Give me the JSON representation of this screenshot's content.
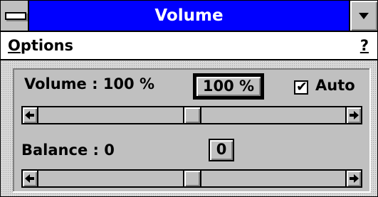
{
  "window": {
    "title": "Volume"
  },
  "menu": {
    "options_label": "Options",
    "help_label": "?"
  },
  "volume": {
    "label": "Volume :  100 %",
    "button_label": "100 %",
    "auto_label": "Auto",
    "auto_checked": true,
    "slider_level": 0.5
  },
  "balance": {
    "label": "Balance :  0",
    "button_label": "0",
    "slider_level": 0.5
  },
  "icons": {
    "system_menu": "system-menu-icon",
    "minimize": "minimize-arrow-icon",
    "scroll_left": "arrow-left-icon",
    "scroll_right": "arrow-right-icon",
    "check": "checkmark-icon"
  },
  "colors": {
    "title_bar": "#0000ff",
    "title_text": "#ffffff",
    "face": "#c0c0c0"
  }
}
